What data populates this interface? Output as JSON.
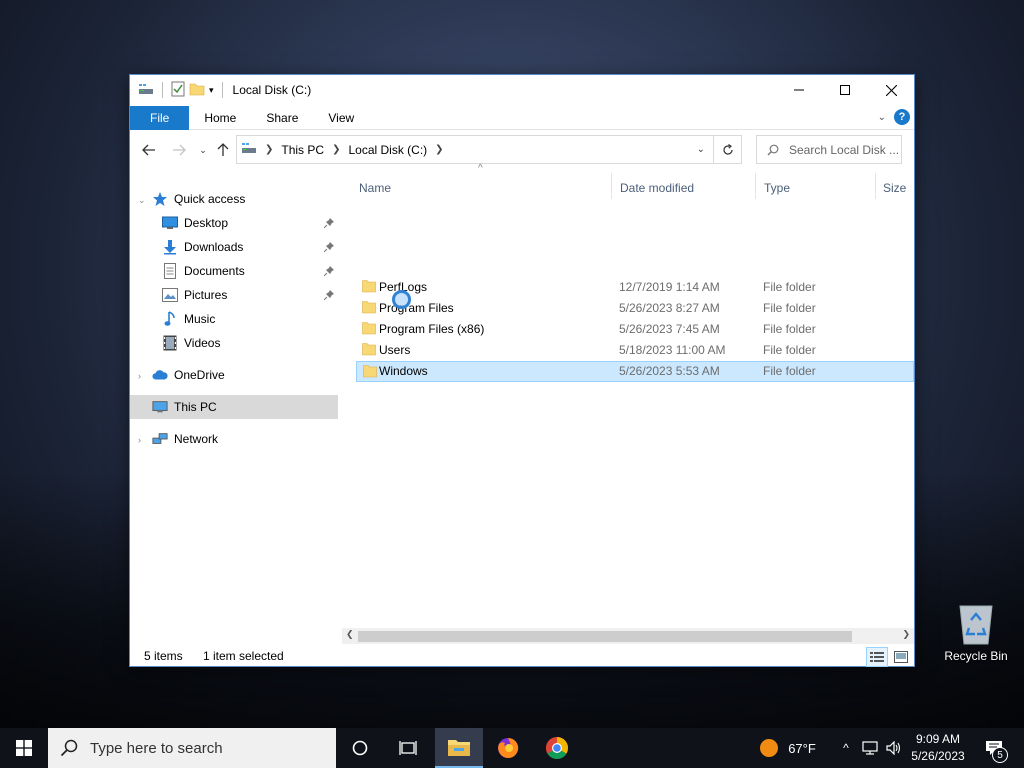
{
  "window": {
    "title": "Local Disk (C:)",
    "controls": {
      "minimize": "—",
      "maximize": "☐",
      "close": "✕"
    }
  },
  "ribbon": {
    "tabs": [
      "File",
      "Home",
      "Share",
      "View"
    ],
    "help_label": "?"
  },
  "navigation": {
    "breadcrumb": [
      "This PC",
      "Local Disk (C:)"
    ],
    "search_placeholder": "Search Local Disk ..."
  },
  "nav_pane": {
    "quick_access": "Quick access",
    "quick_items": [
      {
        "label": "Desktop",
        "icon": "desktop-icon",
        "pinned": true
      },
      {
        "label": "Downloads",
        "icon": "downloads-icon",
        "pinned": true
      },
      {
        "label": "Documents",
        "icon": "documents-icon",
        "pinned": true
      },
      {
        "label": "Pictures",
        "icon": "pictures-icon",
        "pinned": true
      },
      {
        "label": "Music",
        "icon": "music-icon",
        "pinned": false
      },
      {
        "label": "Videos",
        "icon": "videos-icon",
        "pinned": false
      }
    ],
    "onedrive": "OneDrive",
    "this_pc": "This PC",
    "network": "Network"
  },
  "file_list": {
    "columns": [
      "Name",
      "Date modified",
      "Type",
      "Size"
    ],
    "rows": [
      {
        "name": "PerfLogs",
        "date": "12/7/2019 1:14 AM",
        "type": "File folder",
        "selected": false
      },
      {
        "name": "Program Files",
        "date": "5/26/2023 8:27 AM",
        "type": "File folder",
        "selected": false
      },
      {
        "name": "Program Files (x86)",
        "date": "5/26/2023 7:45 AM",
        "type": "File folder",
        "selected": false
      },
      {
        "name": "Users",
        "date": "5/18/2023 11:00 AM",
        "type": "File folder",
        "selected": false
      },
      {
        "name": "Windows",
        "date": "5/26/2023 5:53 AM",
        "type": "File folder",
        "selected": true
      }
    ]
  },
  "status": {
    "item_count": "5 items",
    "selection": "1 item selected"
  },
  "desktop": {
    "recycle_bin": "Recycle Bin"
  },
  "taskbar": {
    "search_placeholder": "Type here to search",
    "weather": "67°F",
    "time": "9:09 AM",
    "date": "5/26/2023",
    "notification_count": "5"
  },
  "colors": {
    "accent": "#1979ca",
    "selection": "#cce8ff",
    "folder": "#f8d775"
  }
}
